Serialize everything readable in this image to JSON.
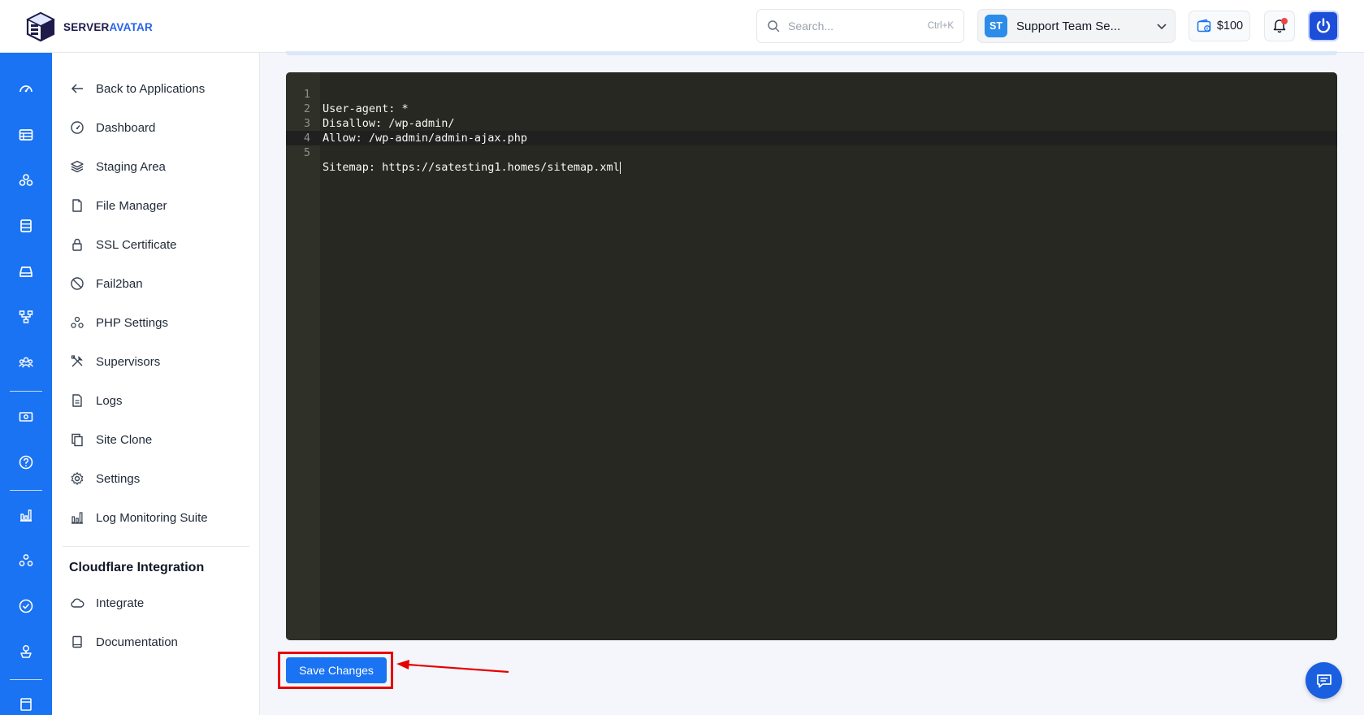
{
  "header": {
    "logo_primary": "SERVER",
    "logo_accent": "AVATAR",
    "search_placeholder": "Search...",
    "search_shortcut": "Ctrl+K",
    "team_initials": "ST",
    "team_name": "Support Team Se...",
    "credit_amount": "$100"
  },
  "rail": {
    "icons": [
      "dashboard-icon",
      "servers-icon",
      "applications-icon",
      "databases-icon",
      "storage-icon",
      "network-icon",
      "team-icon",
      "billing-icon",
      "help-icon",
      "analytics-icon",
      "integrations-icon",
      "checklist-icon",
      "deploy-icon",
      "docs-icon"
    ]
  },
  "subnav": {
    "items": [
      {
        "label": "Back to Applications",
        "icon": "arrow-left-icon"
      },
      {
        "label": "Dashboard",
        "icon": "gauge-icon"
      },
      {
        "label": "Staging Area",
        "icon": "layers-icon"
      },
      {
        "label": "File Manager",
        "icon": "file-icon"
      },
      {
        "label": "SSL Certificate",
        "icon": "lock-icon"
      },
      {
        "label": "Fail2ban",
        "icon": "ban-icon"
      },
      {
        "label": "PHP Settings",
        "icon": "php-settings-icon"
      },
      {
        "label": "Supervisors",
        "icon": "tools-icon"
      },
      {
        "label": "Logs",
        "icon": "document-icon"
      },
      {
        "label": "Site Clone",
        "icon": "copy-icon"
      },
      {
        "label": "Settings",
        "icon": "gear-icon"
      },
      {
        "label": "Log Monitoring Suite",
        "icon": "bar-chart-icon"
      }
    ],
    "section_heading": "Cloudflare Integration",
    "section_items": [
      {
        "label": "Integrate",
        "icon": "cloud-icon"
      },
      {
        "label": "Documentation",
        "icon": "book-icon"
      }
    ]
  },
  "editor": {
    "lines": [
      {
        "number": "1",
        "text": "User-agent: *"
      },
      {
        "number": "2",
        "text": "Disallow: /wp-admin/"
      },
      {
        "number": "3",
        "text": "Allow: /wp-admin/admin-ajax.php"
      },
      {
        "number": "4",
        "text": ""
      },
      {
        "number": "5",
        "text": "Sitemap: https://satesting1.homes/sitemap.xml"
      }
    ],
    "active_line": 5
  },
  "actions": {
    "save_label": "Save Changes"
  },
  "colors": {
    "accent": "#1a73f2",
    "editor_bg": "#272822",
    "highlight": "#e60000"
  }
}
